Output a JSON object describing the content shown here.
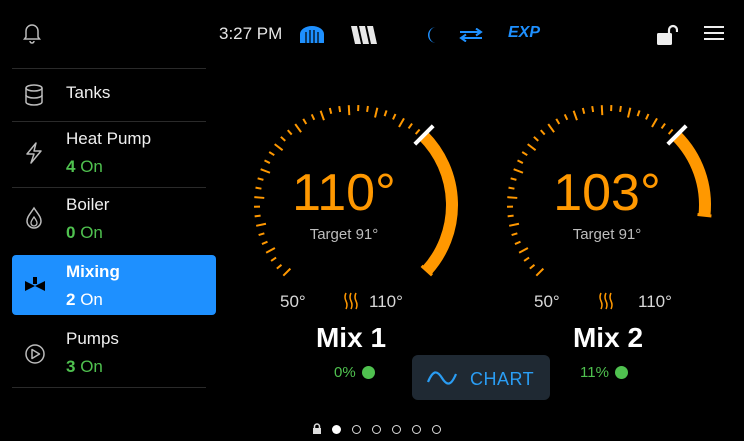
{
  "status_bar": {
    "time": "3:27 PM",
    "mode_label": "EXP",
    "icons": [
      "bell-icon",
      "boiler-icon",
      "w-icon",
      "moon-icon",
      "swap-icon",
      "lock-open-icon",
      "menu-icon"
    ]
  },
  "sidebar": {
    "items": [
      {
        "label": "Tanks",
        "count": "",
        "status": "",
        "icon": "database-icon"
      },
      {
        "label": "Heat Pump",
        "count": "4",
        "status": "On",
        "icon": "bolt-icon"
      },
      {
        "label": "Boiler",
        "count": "0",
        "status": "On",
        "icon": "flame-icon"
      },
      {
        "label": "Mixing",
        "count": "2",
        "status": "On",
        "icon": "valve-icon"
      },
      {
        "label": "Pumps",
        "count": "3",
        "status": "On",
        "icon": "pump-icon"
      }
    ],
    "selected": "Mixing"
  },
  "gauges": [
    {
      "name": "Mix 1",
      "temp": "110°",
      "target": "Target 91°",
      "min_label": "50°",
      "max_label": "110°",
      "percent_label": "0%",
      "status_color": "#4fc14f"
    },
    {
      "name": "Mix 2",
      "temp": "103°",
      "target": "Target 91°",
      "min_label": "50°",
      "max_label": "110°",
      "percent_label": "11%",
      "status_color": "#4fc14f"
    }
  ],
  "chart_button": {
    "label": "CHART"
  },
  "pager": {
    "count": 6,
    "active": 0
  },
  "colors": {
    "accent": "#1e90ff",
    "gauge": "#ff9800",
    "ok": "#4fc14f"
  }
}
